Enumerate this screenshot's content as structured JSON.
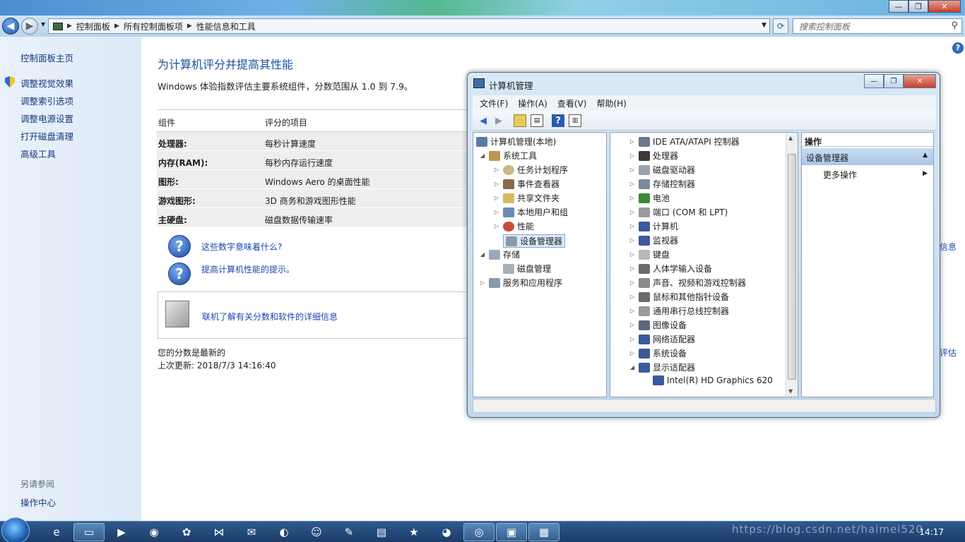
{
  "address_bar": {
    "crumbs": [
      "控制面板",
      "所有控制面板项",
      "性能信息和工具"
    ],
    "search_placeholder": "搜索控制面板"
  },
  "left_pane": {
    "home": "控制面板主页",
    "links": [
      "调整视觉效果",
      "调整索引选项",
      "调整电源设置",
      "打开磁盘清理",
      "高级工具"
    ],
    "see_also_title": "另请参阅",
    "see_also_links": [
      "操作中心"
    ]
  },
  "main": {
    "title": "为计算机评分并提高其性能",
    "intro": "Windows 体验指数评估主要系统组件，分数范围从 1.0 到 7.9。",
    "table": {
      "col_component": "组件",
      "col_rated": "评分的项目",
      "rows": [
        {
          "component": "处理器:",
          "item": "每秒计算速度"
        },
        {
          "component": "内存(RAM):",
          "item": "每秒内存运行速度"
        },
        {
          "component": "图形:",
          "item": "Windows Aero 的桌面性能"
        },
        {
          "component": "游戏图形:",
          "item": "3D 商务和游戏图形性能"
        },
        {
          "component": "主硬盘:",
          "item": "磁盘数据传输速率"
        }
      ]
    },
    "link_meaning": "这些数字意味着什么?",
    "link_tips": "提高计算机性能的提示。",
    "link_online": "联机了解有关分数和软件的详细信息",
    "status_current": "您的分数是最新的",
    "status_last_update": "上次更新: 2018/7/3 14:16:40",
    "peek_right_1": "信息",
    "peek_right_2": "评估"
  },
  "computer_management": {
    "title": "计算机管理",
    "menu": [
      "文件(F)",
      "操作(A)",
      "查看(V)",
      "帮助(H)"
    ],
    "tree": {
      "root": "计算机管理(本地)",
      "system_tools": "系统工具",
      "system_children": [
        "任务计划程序",
        "事件查看器",
        "共享文件夹",
        "本地用户和组",
        "性能",
        "设备管理器"
      ],
      "storage": "存储",
      "storage_children": [
        "磁盘管理"
      ],
      "services": "服务和应用程序"
    },
    "devices": [
      "IDE ATA/ATAPI 控制器",
      "处理器",
      "磁盘驱动器",
      "存储控制器",
      "电池",
      "端口 (COM 和 LPT)",
      "计算机",
      "监视器",
      "键盘",
      "人体学输入设备",
      "声音、视频和游戏控制器",
      "鼠标和其他指针设备",
      "通用串行总线控制器",
      "图像设备",
      "网络适配器",
      "系统设备",
      "显示适配器"
    ],
    "display_adapter_child": "Intel(R) HD Graphics 620",
    "actions": {
      "header": "操作",
      "section": "设备管理器",
      "more": "更多操作"
    }
  },
  "taskbar": {
    "clock": "14:17",
    "watermark": "https://blog.csdn.net/haimei520"
  }
}
